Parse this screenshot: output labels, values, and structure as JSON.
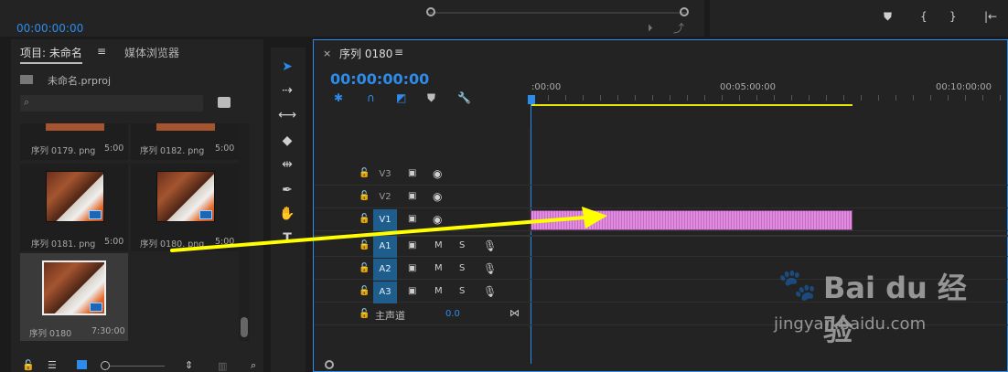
{
  "top_left": {
    "timecode": "00:00:00:00"
  },
  "top_right": {
    "marker_icons": [
      "marker-icon",
      "mark-in-icon",
      "mark-out-icon",
      "go-to-in-icon"
    ]
  },
  "project": {
    "tab_label": "项目: 未命名",
    "menu_glyph": "≡",
    "tab_media": "媒体浏览器",
    "file_name": "未命名.prproj",
    "search_placeholder": "",
    "items": [
      {
        "name": "序列 0179. png",
        "duration": "5:00"
      },
      {
        "name": "序列 0182. png",
        "duration": "5:00"
      },
      {
        "name": "序列 0181. png",
        "duration": "5:00"
      },
      {
        "name": "序列 0180. png",
        "duration": "5:00"
      },
      {
        "name": "序列 0180",
        "duration": "7:30:00"
      }
    ]
  },
  "timeline": {
    "close_glyph": "×",
    "seq_tab": "序列 0180",
    "menu_glyph": "≡",
    "timecode": "00:00:00:00",
    "ruler": [
      ":00:00",
      "00:05:00:00",
      "00:10:00:00"
    ],
    "tracks": {
      "v3": "V3",
      "v2": "V2",
      "v1": "V1",
      "a1": "A1",
      "a2": "A2",
      "a3": "A3",
      "m": "M",
      "s": "S"
    },
    "master": {
      "label": "主声道",
      "value": "0.0"
    }
  },
  "watermark": {
    "brand": "Bai du 经验",
    "url": "jingyan.baidu.com"
  },
  "colors": {
    "accent": "#2d8ceb",
    "clip": "#e38be0",
    "arrow": "#ffff00"
  }
}
